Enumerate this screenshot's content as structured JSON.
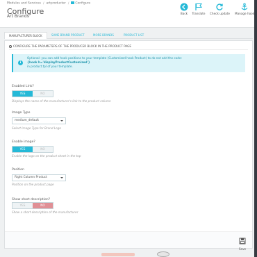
{
  "breadcrumb": {
    "items": [
      "Modules and Services",
      "artproducter",
      "Configure"
    ]
  },
  "header": {
    "title": "Configure",
    "subtitle": "Art Brands"
  },
  "toolbar": {
    "back_label": "Back",
    "translate_label": "Translate",
    "check_update_label": "Check update",
    "manage_hooks_label": "Manage hooks"
  },
  "tabs": [
    {
      "label": "MANUFACTURER BLOCK",
      "active": true
    },
    {
      "label": "SAME BRAND PRODUCT",
      "active": false
    },
    {
      "label": "MORE BRANDS",
      "active": false
    },
    {
      "label": "PRODUCT LIST",
      "active": false
    }
  ],
  "panel": {
    "heading": "CONFIGURE THE PARAMETERS OF THE PRODUCER BLOCK IN THE PRODUCT PAGE"
  },
  "alert": {
    "line1": "Optional: you can add hook positions to your template (Customized hook Product) to do not add the code:",
    "line2": "{hook h='displayProductCustomized'}",
    "line3": "in product.tpl of your template."
  },
  "fields": {
    "enabled_link": {
      "label": "Enabled Link?",
      "yes": "YES",
      "no": "NO",
      "value": "YES",
      "help": "Displays the name of the manufacturer's link to the product column"
    },
    "image_type": {
      "label": "Image Type",
      "value": "medium_default",
      "help": "Select Image Type for Brand Logo"
    },
    "enable_image": {
      "label": "Enable image?",
      "yes": "YES",
      "no": "NO",
      "value": "YES",
      "help": "Enable the logo on the product sheet in the top"
    },
    "position": {
      "label": "Position",
      "value": "Right Column Product",
      "help": "Position on the product page"
    },
    "show_short_description": {
      "label": "Show short description?",
      "yes": "YES",
      "no": "NO",
      "value": "NO",
      "help": "Show a short description of the manufacturer"
    }
  },
  "footer": {
    "save_label": "Save"
  },
  "colors": {
    "accent": "#25b9d7",
    "no_active": "#e08f95",
    "page_bg": "#eff1f2"
  }
}
